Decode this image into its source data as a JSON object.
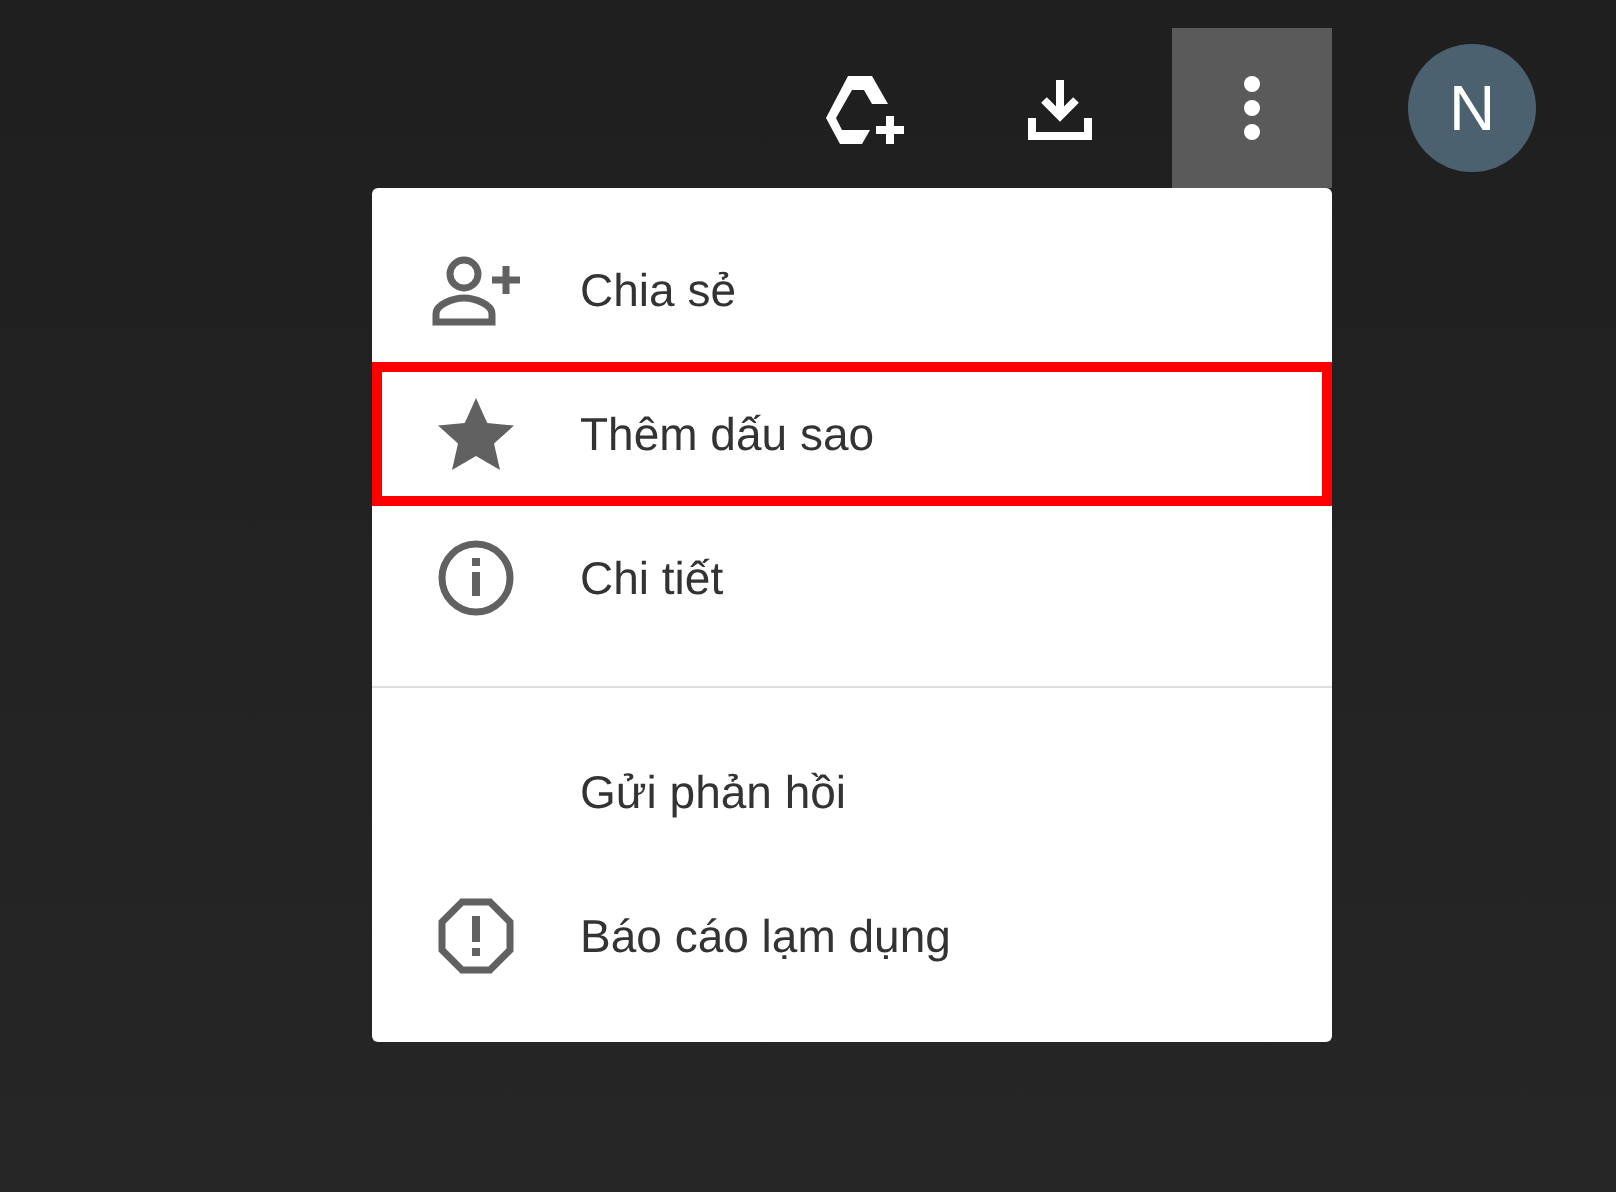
{
  "toolbar": {
    "buttons": [
      {
        "selected": false
      },
      {
        "selected": false
      },
      {
        "selected": true
      }
    ],
    "avatar": {
      "letter": "N"
    }
  },
  "menu": {
    "sections": [
      [
        {
          "label": "Chia sẻ",
          "highlighted": false
        },
        {
          "label": "Thêm dấu sao",
          "highlighted": true
        },
        {
          "label": "Chi tiết",
          "highlighted": false
        }
      ],
      [
        {
          "label": "Gửi phản hồi",
          "highlighted": false
        },
        {
          "label": "Báo cáo lạm dụng",
          "highlighted": false
        }
      ]
    ]
  }
}
